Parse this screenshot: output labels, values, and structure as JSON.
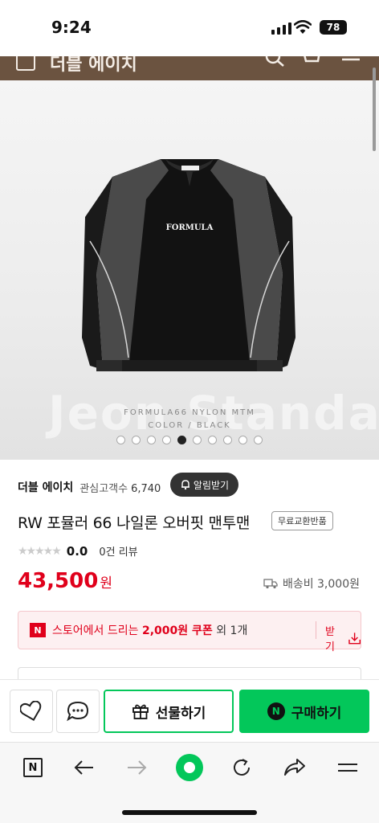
{
  "status_bar": {
    "time": "9:24",
    "battery": "78"
  },
  "header": {
    "store_name": "더블 에이치"
  },
  "hero": {
    "watermark": "Jeon Standard",
    "caption_line1": "FORMULA66 NYLON MTM",
    "caption_line2": "COLOR  / BLACK",
    "chest_print": "FORMULA",
    "dot_count": 10,
    "active_dot": 5
  },
  "store": {
    "name": "더블 에이치",
    "fans_label": "관심고객수",
    "fans_count": "6,740",
    "alarm_label": "알림받기"
  },
  "product": {
    "title": "RW 포뮬러 66 나일론 오버핏 맨투맨",
    "tag": "무료교환반품",
    "rating_score": "0.0",
    "review_label": "0건 리뷰",
    "price": "43,500",
    "currency": "원",
    "shipping": "배송비 3,000원"
  },
  "coupon": {
    "badge": "N",
    "prefix": "스토어에서 드리는 ",
    "amount": "2,000원 쿠폰",
    "suffix": " 외 1개",
    "get_label": "받기"
  },
  "actions": {
    "gift_label": "선물하기",
    "buy_badge": "N",
    "buy_label": "구매하기"
  },
  "toolbar": {
    "tab_badge": "N"
  },
  "colors": {
    "accent": "#03c75a",
    "price": "#e0001b",
    "header": "#6b5340"
  }
}
